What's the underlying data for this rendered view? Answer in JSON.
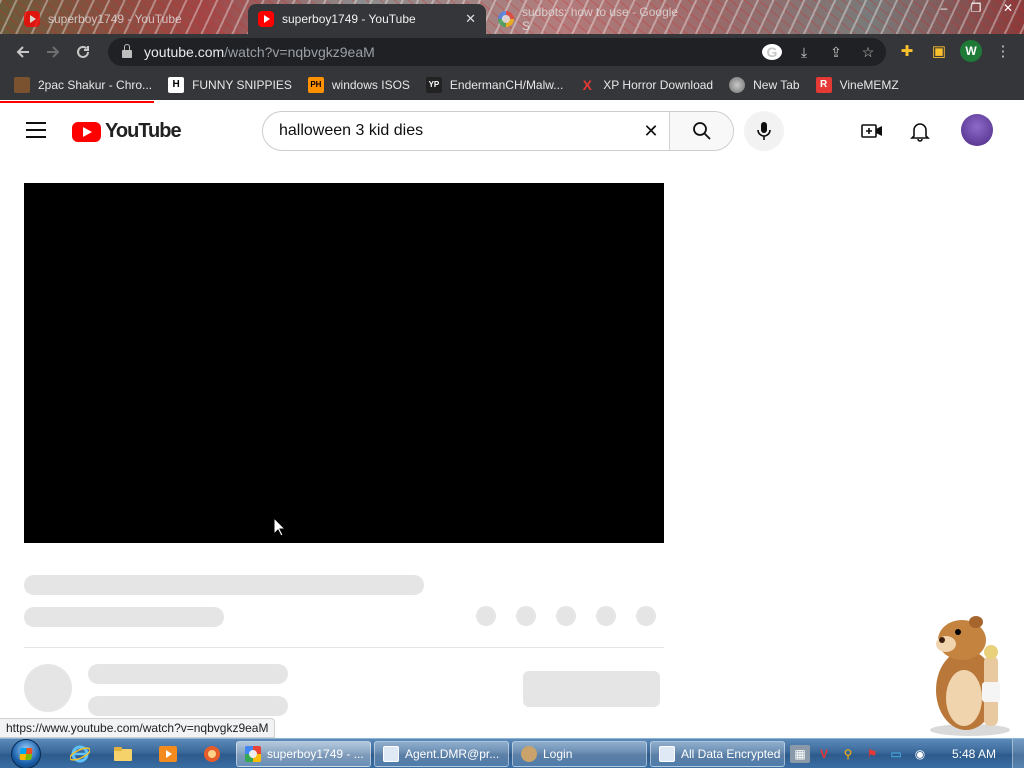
{
  "browser": {
    "tabs": [
      {
        "title": "superboy1749 - YouTube",
        "state": "inactive",
        "favicon": "youtube-icon"
      },
      {
        "title": "superboy1749 - YouTube",
        "state": "active",
        "favicon": "youtube-icon",
        "close": "✕"
      },
      {
        "title": "sudbots: how to use - Google S",
        "state": "inactive",
        "favicon": "google-icon"
      }
    ],
    "window_controls": {
      "minimize": "–",
      "maximize": "❐",
      "close": "✕"
    },
    "address": {
      "domain": "youtube.com",
      "path": "/watch?v=nqbvgkz9eaM"
    },
    "profile_initial": "W",
    "bookmarks": [
      {
        "label": "2pac Shakur - Chro...",
        "icon": "puzzle-icon",
        "icon_text": "",
        "icon_color": "#7a5230"
      },
      {
        "label": "FUNNY SNIPPIES",
        "icon": "h-icon",
        "icon_text": "H",
        "icon_color": "#ffffff"
      },
      {
        "label": "windows ISOS",
        "icon": "ph-icon",
        "icon_text": "PH",
        "icon_color": "#ff9000"
      },
      {
        "label": "EndermanCH/Malw...",
        "icon": "yp-icon",
        "icon_text": "YP",
        "icon_color": "#222222"
      },
      {
        "label": "XP Horror Download",
        "icon": "x-icon",
        "icon_text": "X",
        "icon_color": "#d32f2f"
      },
      {
        "label": "New Tab",
        "icon": "globe-icon",
        "icon_text": "",
        "icon_color": "#9aa0a6"
      },
      {
        "label": "VineMEMZ",
        "icon": "r-icon",
        "icon_text": "R",
        "icon_color": "#e53935"
      }
    ]
  },
  "youtube": {
    "logo_text": "YouTube",
    "search_query": "halloween 3 kid dies",
    "clear_glyph": "✕"
  },
  "status_url": "https://www.youtube.com/watch?v=nqbvgkz9eaM",
  "taskbar": {
    "items": [
      {
        "label": "superboy1749 - ...",
        "icon": "chrome-icon",
        "active": true
      },
      {
        "label": "Agent.DMR@pr...",
        "icon": "window-icon",
        "active": false
      },
      {
        "label": "Login",
        "icon": "user-icon",
        "active": false
      },
      {
        "label": "All Data Encrypted",
        "icon": "window-icon",
        "active": false
      }
    ],
    "time": "5:48 AM"
  },
  "colors": {
    "youtube_red": "#ff0000",
    "chrome_dark": "#35363a",
    "skeleton": "#e5e5e5"
  }
}
